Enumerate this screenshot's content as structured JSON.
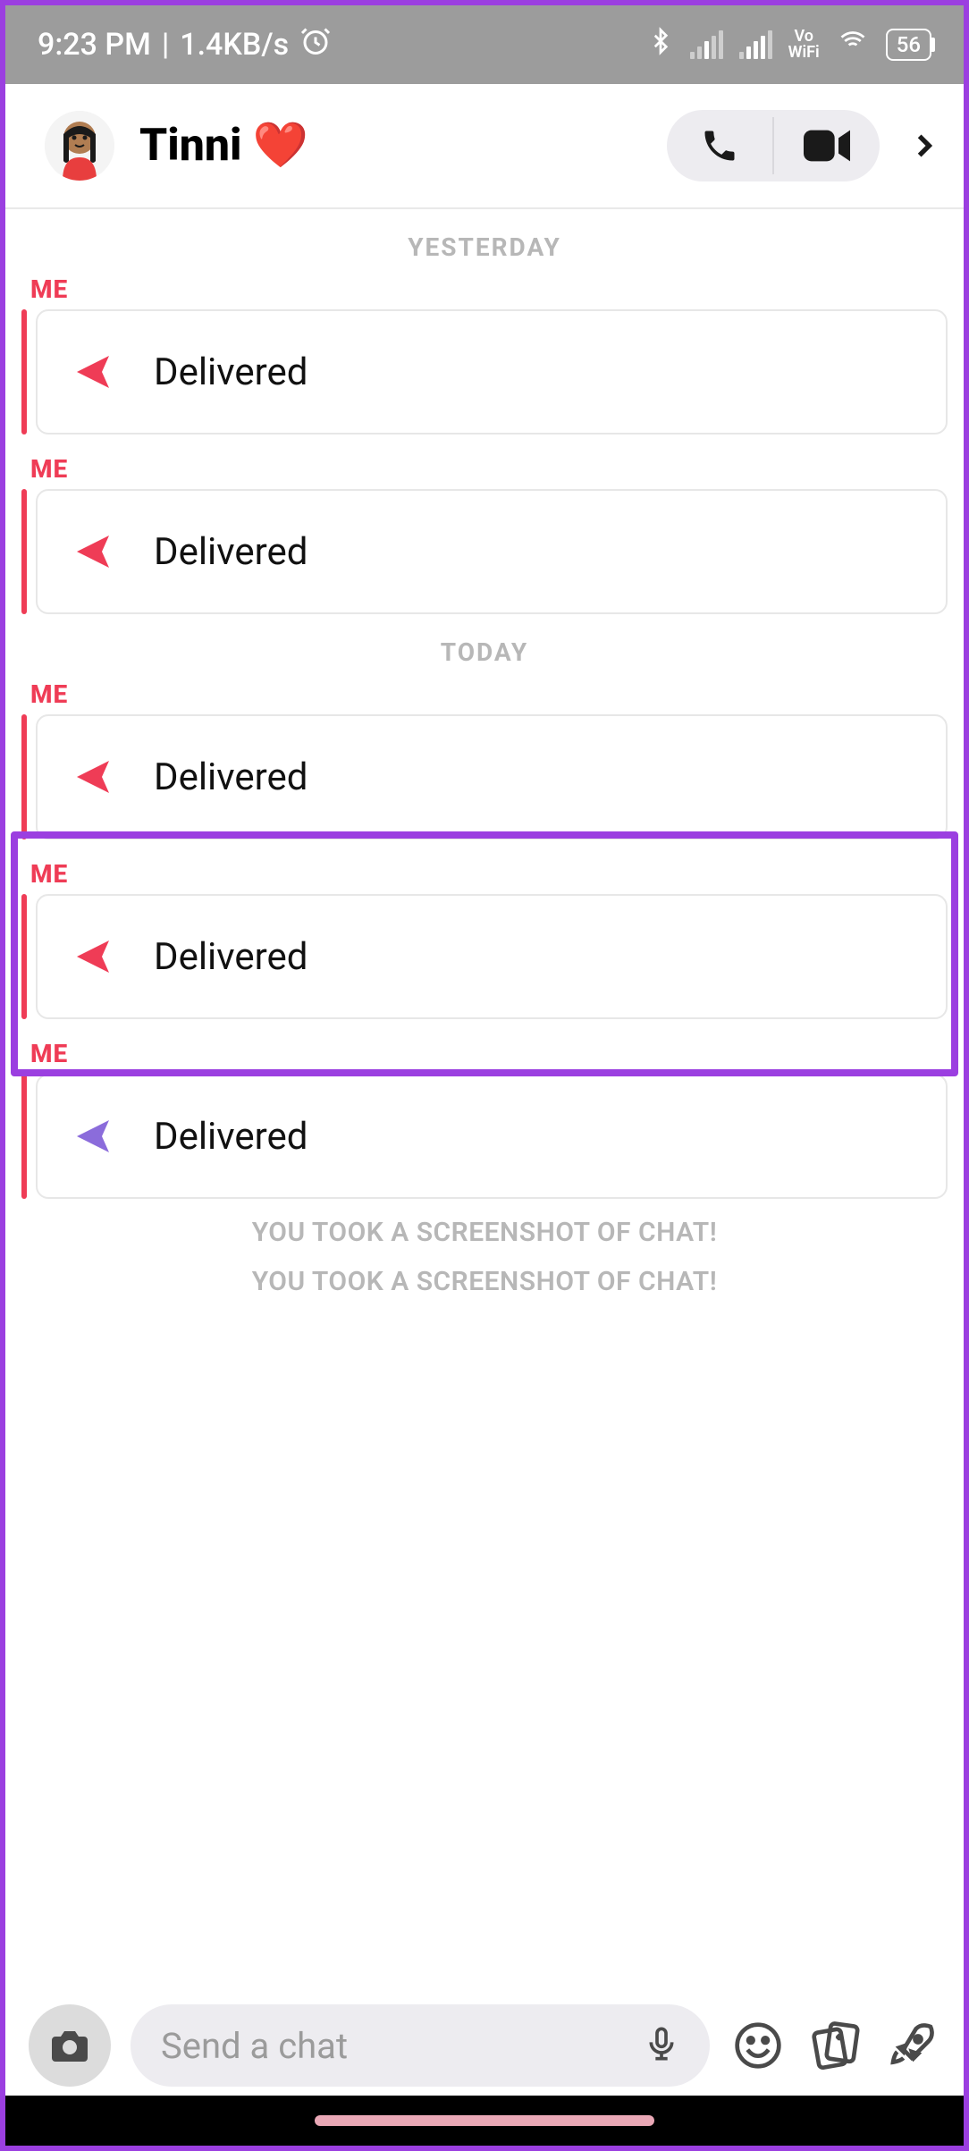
{
  "status_bar": {
    "time": "9:23 PM",
    "data_rate": "1.4KB/s",
    "vowifi": "Vo\nWiFi",
    "battery": "56"
  },
  "header": {
    "contact_name": "Tinni",
    "heart": "❤️"
  },
  "separators": {
    "yesterday": "YESTERDAY",
    "today": "TODAY"
  },
  "sender_me": "ME",
  "messages": {
    "delivered": "Delivered"
  },
  "system": {
    "screenshot_1": "YOU TOOK A SCREENSHOT OF CHAT!",
    "screenshot_2": "YOU TOOK A SCREENSHOT OF CHAT!"
  },
  "footer": {
    "placeholder": "Send a chat"
  }
}
